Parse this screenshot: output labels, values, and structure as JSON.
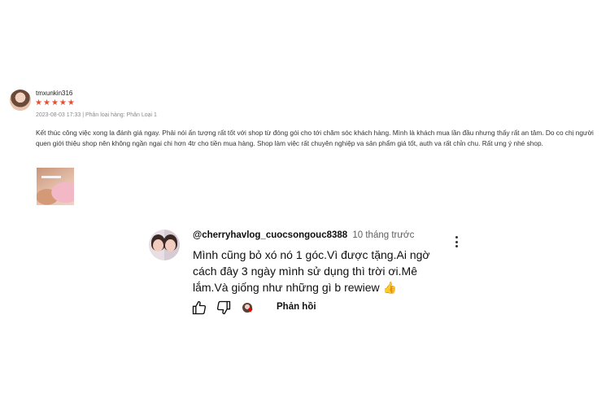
{
  "review": {
    "username": "tmxunkin316",
    "rating": 5,
    "meta": "2023-08-03 17:33 | Phân loại hàng: Phân Loại 1",
    "text": "Kết thúc công việc xong la đánh giá ngay. Phải nói ấn tượng rất tốt với shop từ đóng gói cho tới chăm sóc khách hàng. Mình là khách mua lần đầu nhưng thấy rất an tâm. Do co chị người quen giới thiệu shop nên không ngần ngại chi hơn 4tr cho tiền mua hàng. Shop làm việc rất chuyên nghiệp va sản phẩm giá tốt, auth va rất chỉn chu. Rất ưng ý nhé shop."
  },
  "comment": {
    "author": "@cherryhavlog_cuocsongouc8388",
    "time": "10 tháng trước",
    "text": "Mình cũng bỏ xó nó 1 góc.Vì được tặng.Ai ngờ cách đây 3 ngày mình sử dụng thì trời ơi.Mê lắm.Và giống như những gì b rewiew 👍",
    "reply_label": "Phản hồi"
  },
  "icons": [
    "like-icon",
    "dislike-icon",
    "creator-heart-icon",
    "more-vert-icon",
    "star-icon"
  ],
  "colors": {
    "star": "#ee4d2d",
    "heart": "#ee0000"
  }
}
